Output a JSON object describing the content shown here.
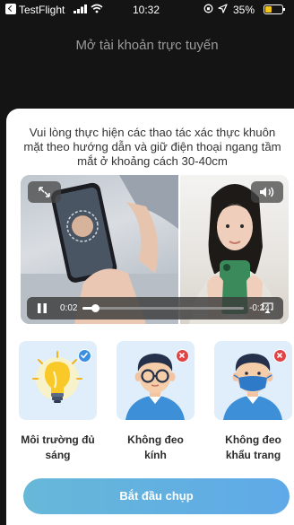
{
  "status_bar": {
    "app_name": "TestFlight",
    "time": "10:32",
    "battery_percent": "35%",
    "battery_level": 0.35,
    "battery_color": "#f2c51b"
  },
  "header": {
    "title": "Mở tài khoản trực tuyến"
  },
  "instruction": "Vui lòng thực hiện các thao tác xác thực khuôn mặt theo hướng dẫn và giữ điện thoại ngang tầm mắt ở khoảng cách 30-40cm",
  "video": {
    "current_time": "0:02",
    "remaining_time": "-0:24",
    "progress": 0.08,
    "buttons": {
      "expand_icon": "expand-icon",
      "volume_icon": "speaker-icon",
      "play_icon": "pause-icon",
      "airplay_icon": "airplay-icon"
    }
  },
  "requirements": [
    {
      "label": "Môi trường đủ sáng",
      "status": "ok",
      "icon": "light-bulb-icon"
    },
    {
      "label": "Không đeo kính",
      "status": "not-allowed",
      "icon": "glasses-icon"
    },
    {
      "label": "Không đeo khẩu trang",
      "status": "not-allowed",
      "icon": "face-mask-icon"
    }
  ],
  "colors": {
    "ok_badge": "#3b8fe0",
    "not_allowed_badge": "#e04545",
    "card_bg": "#dfeefa",
    "button_start": "#66b8d8",
    "button_end": "#5fa9e8"
  },
  "start_button": {
    "label": "Bắt đầu chụp"
  }
}
